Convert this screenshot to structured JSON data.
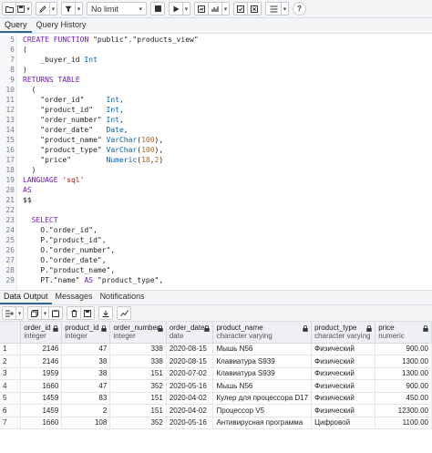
{
  "toolbar": {
    "limit_select": "No limit",
    "icons": [
      "folder-icon",
      "save-icon",
      "edit-icon",
      "filter-icon",
      "stop-icon",
      "execute-icon",
      "explain-icon",
      "commit-icon",
      "rollback-icon",
      "macros-icon",
      "help-icon"
    ]
  },
  "query_tabs": [
    "Query",
    "Query History"
  ],
  "editor": {
    "lines": [
      {
        "n": "5",
        "t": "CREATE FUNCTION \"public\".\"products_view\""
      },
      {
        "n": "6",
        "t": "("
      },
      {
        "n": "7",
        "t": "    _buyer_id Int"
      },
      {
        "n": "8",
        "t": ")"
      },
      {
        "n": "9",
        "t": "RETURNS TABLE"
      },
      {
        "n": "10",
        "t": "  ("
      },
      {
        "n": "11",
        "t": "    \"order_id\"     Int,"
      },
      {
        "n": "12",
        "t": "    \"product_id\"   Int,"
      },
      {
        "n": "13",
        "t": "    \"order_number\" Int,"
      },
      {
        "n": "14",
        "t": "    \"order_date\"   Date,"
      },
      {
        "n": "15",
        "t": "    \"product_name\" VarChar(100),"
      },
      {
        "n": "16",
        "t": "    \"product_type\" VarChar(100),"
      },
      {
        "n": "17",
        "t": "    \"price\"        Numeric(18,2)"
      },
      {
        "n": "18",
        "t": "  )"
      },
      {
        "n": "19",
        "t": "LANGUAGE 'sql'"
      },
      {
        "n": "20",
        "t": "AS"
      },
      {
        "n": "21",
        "t": "$$"
      },
      {
        "n": "22",
        "t": ""
      },
      {
        "n": "23",
        "t": "  SELECT"
      },
      {
        "n": "24",
        "t": "    O.\"order_id\","
      },
      {
        "n": "25",
        "t": "    P.\"product_id\","
      },
      {
        "n": "26",
        "t": "    O.\"order_number\","
      },
      {
        "n": "27",
        "t": "    O.\"order_date\","
      },
      {
        "n": "28",
        "t": "    P.\"product_name\","
      },
      {
        "n": "29",
        "t": "    PT.\"name\" AS \"product_type\","
      }
    ]
  },
  "output_tabs": [
    "Data Output",
    "Messages",
    "Notifications"
  ],
  "grid": {
    "columns": [
      {
        "name": "order_id",
        "type": "integer"
      },
      {
        "name": "product_id",
        "type": "integer"
      },
      {
        "name": "order_number",
        "type": "integer"
      },
      {
        "name": "order_date",
        "type": "date"
      },
      {
        "name": "product_name",
        "type": "character varying"
      },
      {
        "name": "product_type",
        "type": "character varying"
      },
      {
        "name": "price",
        "type": "numeric"
      }
    ],
    "rows": [
      [
        "1",
        "2146",
        "47",
        "338",
        "2020-08-15",
        "Мышь N56",
        "Физический",
        "900.00"
      ],
      [
        "2",
        "2146",
        "38",
        "338",
        "2020-08-15",
        "Клавиатура S939",
        "Физический",
        "1300.00"
      ],
      [
        "3",
        "1959",
        "38",
        "151",
        "2020-07-02",
        "Клавиатура S939",
        "Физический",
        "1300.00"
      ],
      [
        "4",
        "1660",
        "47",
        "352",
        "2020-05-16",
        "Мышь N56",
        "Физический",
        "900.00"
      ],
      [
        "5",
        "1459",
        "83",
        "151",
        "2020-04-02",
        "Кулер для процессора D17",
        "Физический",
        "450.00"
      ],
      [
        "6",
        "1459",
        "2",
        "151",
        "2020-04-02",
        "Процессор V5",
        "Физический",
        "12300.00"
      ],
      [
        "7",
        "1660",
        "108",
        "352",
        "2020-05-16",
        "Антивирусная программа",
        "Цифровой",
        "1100.00"
      ]
    ]
  }
}
